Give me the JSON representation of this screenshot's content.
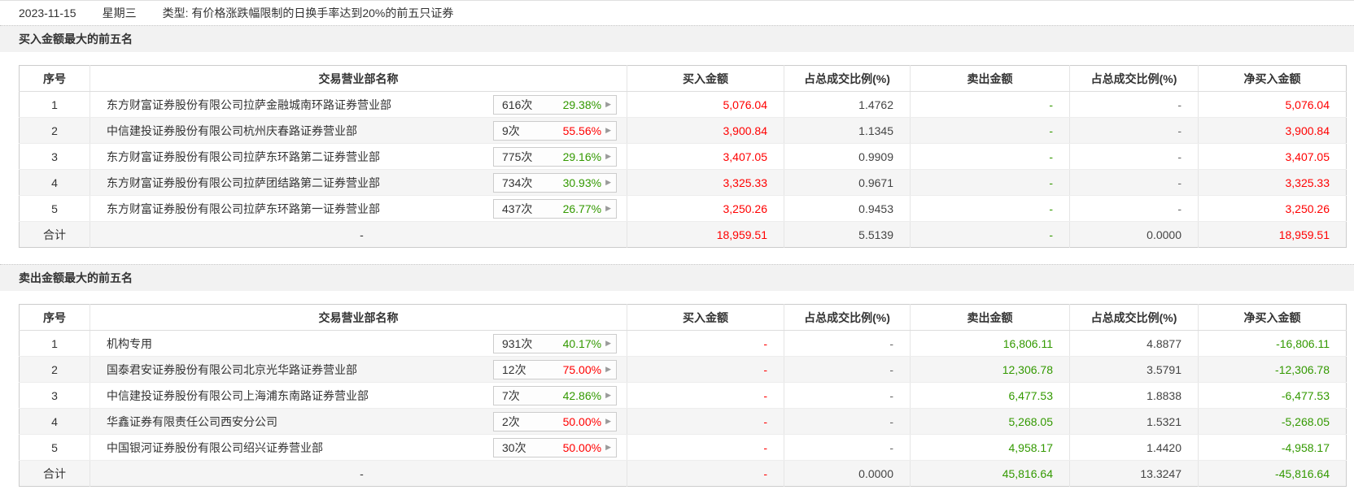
{
  "page": {
    "date": "2023-11-15",
    "weekday": "星期三",
    "type_label": "类型: 有价格涨跌幅限制的日换手率达到20%的前五只证券"
  },
  "colors": {
    "red": "#ff0000",
    "green": "#339900",
    "dark_text": "#444444",
    "gray_text": "#666666",
    "band_bg": "#f2f2f2",
    "stripe_bg": "#f5f5f5"
  },
  "tables": [
    {
      "title": "买入金额最大的前五名",
      "columns": [
        "序号",
        "交易营业部名称",
        "买入金额",
        "占总成交比例(%)",
        "卖出金额",
        "占总成交比例(%)",
        "净买入金额"
      ],
      "rows": [
        {
          "seq": "1",
          "name": "东方财富证券股份有限公司拉萨金融城南环路证券营业部",
          "badge": {
            "count": "616次",
            "pct": "29.38%",
            "c": "green"
          },
          "buy": {
            "t": "5,076.04",
            "c": "red"
          },
          "pct1": {
            "t": "1.4762",
            "c": "dark"
          },
          "sell": {
            "t": "-",
            "c": "green"
          },
          "pct2": {
            "t": "-",
            "c": "gray"
          },
          "net": {
            "t": "5,076.04",
            "c": "red"
          }
        },
        {
          "seq": "2",
          "name": "中信建投证券股份有限公司杭州庆春路证券营业部",
          "badge": {
            "count": "9次",
            "pct": "55.56%",
            "c": "red"
          },
          "buy": {
            "t": "3,900.84",
            "c": "red"
          },
          "pct1": {
            "t": "1.1345",
            "c": "dark"
          },
          "sell": {
            "t": "-",
            "c": "green"
          },
          "pct2": {
            "t": "-",
            "c": "gray"
          },
          "net": {
            "t": "3,900.84",
            "c": "red"
          }
        },
        {
          "seq": "3",
          "name": "东方财富证券股份有限公司拉萨东环路第二证券营业部",
          "badge": {
            "count": "775次",
            "pct": "29.16%",
            "c": "green"
          },
          "buy": {
            "t": "3,407.05",
            "c": "red"
          },
          "pct1": {
            "t": "0.9909",
            "c": "dark"
          },
          "sell": {
            "t": "-",
            "c": "green"
          },
          "pct2": {
            "t": "-",
            "c": "gray"
          },
          "net": {
            "t": "3,407.05",
            "c": "red"
          }
        },
        {
          "seq": "4",
          "name": "东方财富证券股份有限公司拉萨团结路第二证券营业部",
          "badge": {
            "count": "734次",
            "pct": "30.93%",
            "c": "green"
          },
          "buy": {
            "t": "3,325.33",
            "c": "red"
          },
          "pct1": {
            "t": "0.9671",
            "c": "dark"
          },
          "sell": {
            "t": "-",
            "c": "green"
          },
          "pct2": {
            "t": "-",
            "c": "gray"
          },
          "net": {
            "t": "3,325.33",
            "c": "red"
          }
        },
        {
          "seq": "5",
          "name": "东方财富证券股份有限公司拉萨东环路第一证券营业部",
          "badge": {
            "count": "437次",
            "pct": "26.77%",
            "c": "green"
          },
          "buy": {
            "t": "3,250.26",
            "c": "red"
          },
          "pct1": {
            "t": "0.9453",
            "c": "dark"
          },
          "sell": {
            "t": "-",
            "c": "green"
          },
          "pct2": {
            "t": "-",
            "c": "gray"
          },
          "net": {
            "t": "3,250.26",
            "c": "red"
          }
        },
        {
          "seq": "合计",
          "name": "-",
          "badge": null,
          "buy": {
            "t": "18,959.51",
            "c": "red"
          },
          "pct1": {
            "t": "5.5139",
            "c": "dark"
          },
          "sell": {
            "t": "-",
            "c": "green"
          },
          "pct2": {
            "t": "0.0000",
            "c": "dark"
          },
          "net": {
            "t": "18,959.51",
            "c": "red"
          }
        }
      ]
    },
    {
      "title": "卖出金额最大的前五名",
      "columns": [
        "序号",
        "交易营业部名称",
        "买入金额",
        "占总成交比例(%)",
        "卖出金额",
        "占总成交比例(%)",
        "净买入金额"
      ],
      "rows": [
        {
          "seq": "1",
          "name": "机构专用",
          "badge": {
            "count": "931次",
            "pct": "40.17%",
            "c": "green"
          },
          "buy": {
            "t": "-",
            "c": "red"
          },
          "pct1": {
            "t": "-",
            "c": "gray"
          },
          "sell": {
            "t": "16,806.11",
            "c": "green"
          },
          "pct2": {
            "t": "4.8877",
            "c": "dark"
          },
          "net": {
            "t": "-16,806.11",
            "c": "green"
          }
        },
        {
          "seq": "2",
          "name": "国泰君安证券股份有限公司北京光华路证券营业部",
          "badge": {
            "count": "12次",
            "pct": "75.00%",
            "c": "red"
          },
          "buy": {
            "t": "-",
            "c": "red"
          },
          "pct1": {
            "t": "-",
            "c": "gray"
          },
          "sell": {
            "t": "12,306.78",
            "c": "green"
          },
          "pct2": {
            "t": "3.5791",
            "c": "dark"
          },
          "net": {
            "t": "-12,306.78",
            "c": "green"
          }
        },
        {
          "seq": "3",
          "name": "中信建投证券股份有限公司上海浦东南路证券营业部",
          "badge": {
            "count": "7次",
            "pct": "42.86%",
            "c": "green"
          },
          "buy": {
            "t": "-",
            "c": "red"
          },
          "pct1": {
            "t": "-",
            "c": "gray"
          },
          "sell": {
            "t": "6,477.53",
            "c": "green"
          },
          "pct2": {
            "t": "1.8838",
            "c": "dark"
          },
          "net": {
            "t": "-6,477.53",
            "c": "green"
          }
        },
        {
          "seq": "4",
          "name": "华鑫证券有限责任公司西安分公司",
          "badge": {
            "count": "2次",
            "pct": "50.00%",
            "c": "red"
          },
          "buy": {
            "t": "-",
            "c": "red"
          },
          "pct1": {
            "t": "-",
            "c": "gray"
          },
          "sell": {
            "t": "5,268.05",
            "c": "green"
          },
          "pct2": {
            "t": "1.5321",
            "c": "dark"
          },
          "net": {
            "t": "-5,268.05",
            "c": "green"
          }
        },
        {
          "seq": "5",
          "name": "中国银河证券股份有限公司绍兴证券营业部",
          "badge": {
            "count": "30次",
            "pct": "50.00%",
            "c": "red"
          },
          "buy": {
            "t": "-",
            "c": "red"
          },
          "pct1": {
            "t": "-",
            "c": "gray"
          },
          "sell": {
            "t": "4,958.17",
            "c": "green"
          },
          "pct2": {
            "t": "1.4420",
            "c": "dark"
          },
          "net": {
            "t": "-4,958.17",
            "c": "green"
          }
        },
        {
          "seq": "合计",
          "name": "-",
          "badge": null,
          "buy": {
            "t": "-",
            "c": "red"
          },
          "pct1": {
            "t": "0.0000",
            "c": "dark"
          },
          "sell": {
            "t": "45,816.64",
            "c": "green"
          },
          "pct2": {
            "t": "13.3247",
            "c": "dark"
          },
          "net": {
            "t": "-45,816.64",
            "c": "green"
          }
        }
      ]
    }
  ],
  "icons": {
    "chevron_right": "▶"
  }
}
